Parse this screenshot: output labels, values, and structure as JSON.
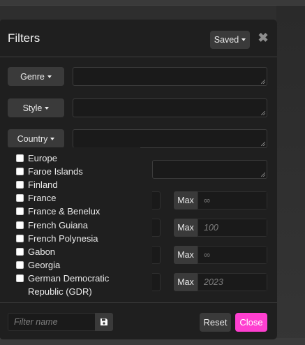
{
  "modal": {
    "title": "Filters",
    "saved_button": "Saved",
    "close_glyph": "✖"
  },
  "filters": {
    "genre_label": "Genre",
    "style_label": "Style",
    "country_label": "Country"
  },
  "country_options": [
    "Europe",
    "Faroe Islands",
    "Finland",
    "France",
    "France & Benelux",
    "French Guiana",
    "French Polynesia",
    "Gabon",
    "Georgia",
    "German Democratic",
    "Republic (GDR)"
  ],
  "ranges": [
    {
      "label": "Max",
      "placeholder": "∞"
    },
    {
      "label": "Max",
      "placeholder": "100"
    },
    {
      "label": "Max",
      "placeholder": "∞"
    },
    {
      "label": "Max",
      "placeholder": "2023"
    }
  ],
  "footer": {
    "filter_name_placeholder": "Filter name",
    "reset_label": "Reset",
    "close_label": "Close"
  },
  "colors": {
    "accent": "#ff3fd0",
    "modal_bg": "#1f1f1f",
    "button_bg": "#3a3a3a"
  },
  "icons": {
    "save": "save-icon",
    "caret": "caret-down-icon",
    "close": "close-icon"
  }
}
